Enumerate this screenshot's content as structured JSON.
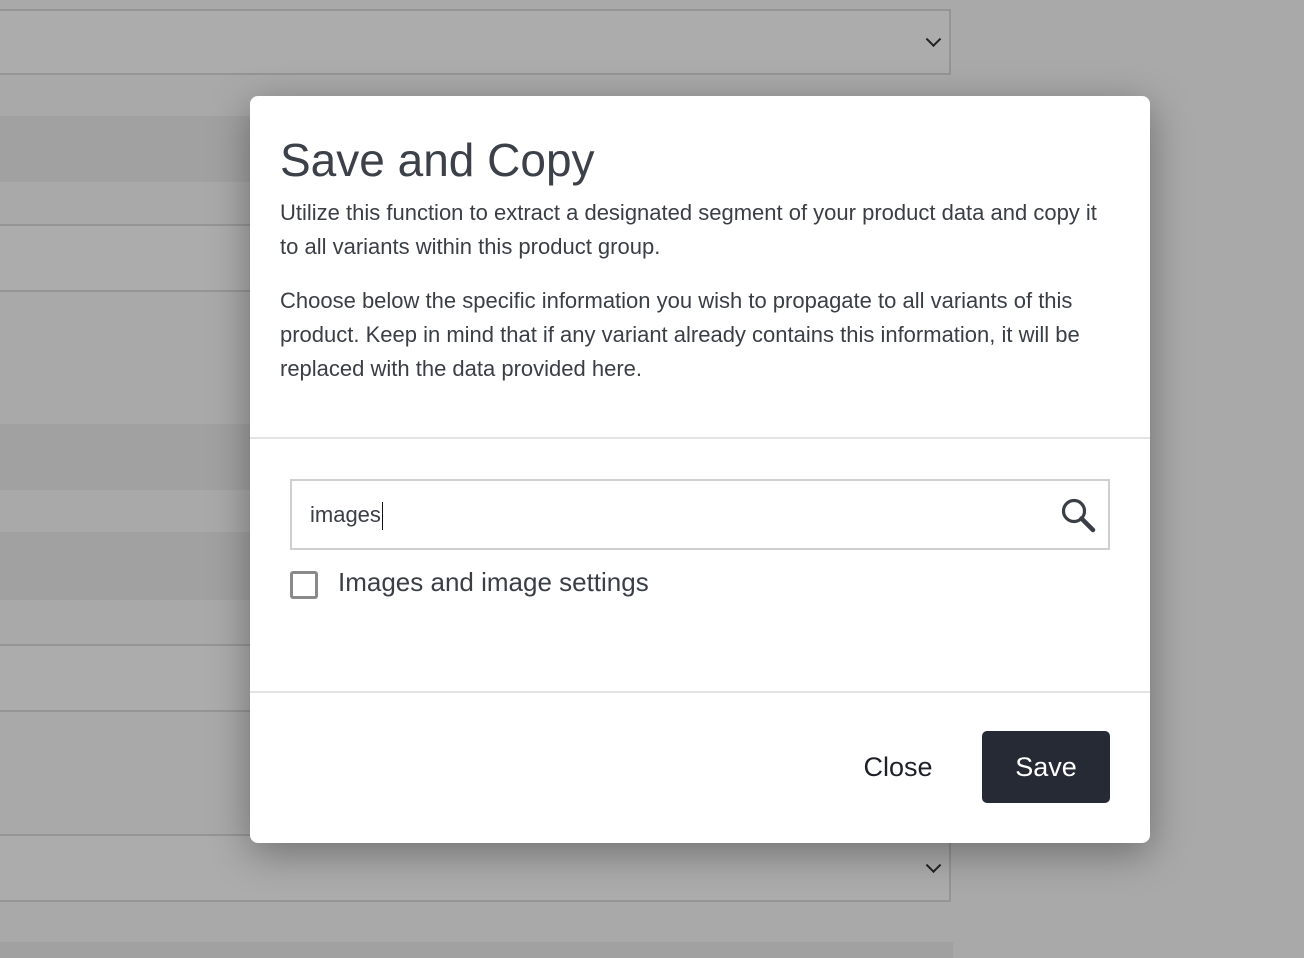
{
  "modal": {
    "title": "Save and Copy",
    "description_1": "Utilize this function to extract a designated segment of your product data and copy it to all variants within this product group.",
    "description_2": "Choose below the specific information you wish to propagate to all variants of this product. Keep in mind that if any variant already contains this information, it will be replaced with the data provided here.",
    "search": {
      "value": "images",
      "icon": "search-icon"
    },
    "options": [
      {
        "label": "Images and image settings",
        "checked": false
      }
    ],
    "buttons": {
      "close_label": "Close",
      "save_label": "Save"
    }
  },
  "colors": {
    "overlay": "#a8a8a8",
    "primary_button": "#262a35",
    "text": "#3a3e45"
  }
}
